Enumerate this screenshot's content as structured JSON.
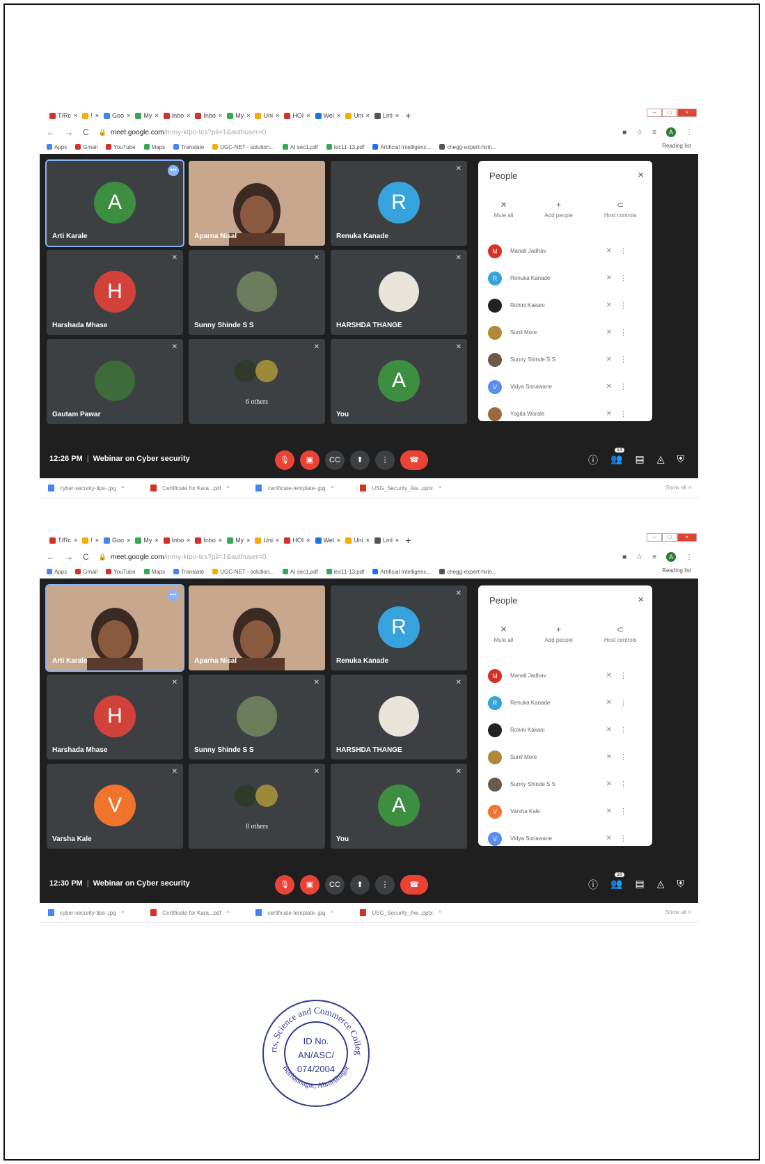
{
  "browser": {
    "tabs": [
      {
        "label": "T/Rc",
        "color": "#d93025"
      },
      {
        "label": "!",
        "color": "#f9ab00"
      },
      {
        "label": "Goo",
        "color": "#4285f4"
      },
      {
        "label": "My",
        "color": "#34a853"
      },
      {
        "label": "Inbo",
        "color": "#d93025"
      },
      {
        "label": "Inbo",
        "color": "#d93025"
      },
      {
        "label": "My",
        "color": "#34a853"
      },
      {
        "label": "Uni",
        "color": "#f9ab00"
      },
      {
        "label": "HOI",
        "color": "#d93025"
      },
      {
        "label": "Wel",
        "color": "#1a73e8"
      },
      {
        "label": "Uni",
        "color": "#f9ab00"
      },
      {
        "label": "Linl",
        "color": "#555555"
      }
    ],
    "url_host": "meet.google.com",
    "url_path_1": "/mmy-ktpo-tcs?pli=1&authuser=0",
    "url_path_2": "/mmy-ktpo-tcs?pli=1&authuser=0",
    "bookmarks": [
      {
        "label": "Apps",
        "color": "#4285f4"
      },
      {
        "label": "Gmail",
        "color": "#d93025"
      },
      {
        "label": "YouTube",
        "color": "#d93025"
      },
      {
        "label": "Maps",
        "color": "#34a853"
      },
      {
        "label": "Translate",
        "color": "#4285f4"
      },
      {
        "label": "UGC-NET - solution...",
        "color": "#f9ab00"
      },
      {
        "label": "AI sec1.pdf",
        "color": "#34a853"
      },
      {
        "label": "lec11-13.pdf",
        "color": "#34a853"
      },
      {
        "label": "Artificial Intelligenc...",
        "color": "#1a73e8"
      },
      {
        "label": "chegg-expert-hirin...",
        "color": "#555555"
      }
    ],
    "reading_list": "Reading list"
  },
  "shot1": {
    "tiles": [
      {
        "name": "Arti Karale",
        "letter": "A",
        "color": "#3e8e41",
        "kind": "avatar",
        "active": true
      },
      {
        "name": "Aparna Nisal",
        "kind": "video"
      },
      {
        "name": "Renuka Kanade",
        "letter": "R",
        "color": "#36a3dd",
        "kind": "avatar"
      },
      {
        "name": "Harshada Mhase",
        "letter": "H",
        "color": "#d3423a",
        "kind": "avatar"
      },
      {
        "name": "Sunny Shinde S S",
        "kind": "photo",
        "photo_color": "#6b7d5a"
      },
      {
        "name": "HARSHDA THANGE",
        "kind": "photo",
        "photo_color": "#e9e4da"
      },
      {
        "name": "Gautam Pawar",
        "kind": "photo",
        "photo_color": "#3e6b3a"
      },
      {
        "name": "6 others",
        "kind": "others"
      },
      {
        "name": "You",
        "letter": "A",
        "color": "#3e8e41",
        "kind": "avatar"
      }
    ],
    "people": [
      {
        "name": "Manali Jadhav",
        "letter": "M",
        "color": "#d93025"
      },
      {
        "name": "Renuka Kanade",
        "letter": "R",
        "color": "#36a3dd"
      },
      {
        "name": "Rohini Kakani",
        "letter": "",
        "color": "#222222"
      },
      {
        "name": "Sunil More",
        "letter": "",
        "color": "#b08a3a"
      },
      {
        "name": "Sunny Shinde S S",
        "letter": "",
        "color": "#6b5a4a"
      },
      {
        "name": "Vidya Sonawane",
        "letter": "V",
        "color": "#5b8def"
      },
      {
        "name": "Yogita Warale",
        "letter": "",
        "color": "#9a6a3a"
      }
    ],
    "time": "12:26 PM",
    "people_count": "14"
  },
  "shot2": {
    "tiles": [
      {
        "name": "Arti Karale",
        "kind": "video",
        "active": true
      },
      {
        "name": "Aparna Nisal",
        "kind": "video"
      },
      {
        "name": "Renuka Kanade",
        "letter": "R",
        "color": "#36a3dd",
        "kind": "avatar"
      },
      {
        "name": "Harshada Mhase",
        "letter": "H",
        "color": "#d3423a",
        "kind": "avatar"
      },
      {
        "name": "Sunny Shinde S S",
        "kind": "photo",
        "photo_color": "#6b7d5a"
      },
      {
        "name": "HARSHDA THANGE",
        "kind": "photo",
        "photo_color": "#e9e4da"
      },
      {
        "name": "Varsha Kale",
        "letter": "V",
        "color": "#f2742c",
        "kind": "avatar"
      },
      {
        "name": "8 others",
        "kind": "others"
      },
      {
        "name": "You",
        "letter": "A",
        "color": "#3e8e41",
        "kind": "avatar"
      }
    ],
    "people": [
      {
        "name": "Manali Jadhav",
        "letter": "M",
        "color": "#d93025"
      },
      {
        "name": "Renuka Kanade",
        "letter": "R",
        "color": "#36a3dd"
      },
      {
        "name": "Rohini Kakani",
        "letter": "",
        "color": "#222222"
      },
      {
        "name": "Sunil More",
        "letter": "",
        "color": "#b08a3a"
      },
      {
        "name": "Sunny Shinde S S",
        "letter": "",
        "color": "#6b5a4a"
      },
      {
        "name": "Varsha Kale",
        "letter": "V",
        "color": "#f2742c"
      },
      {
        "name": "Vidya Sonawane",
        "letter": "V",
        "color": "#5b8def"
      }
    ],
    "time": "12:30 PM",
    "people_count": "16"
  },
  "meeting_title": "Webinar on Cyber security",
  "people_panel": {
    "title": "People",
    "mute_all": "Mute all",
    "add_people": "Add people",
    "host_controls": "Host controls"
  },
  "downloads": [
    {
      "label": "cyber-security-tips-.jpg",
      "color": "#4285f4"
    },
    {
      "label": "Certificate for Kara...pdf",
      "color": "#d93025"
    },
    {
      "label": "certificate-template-.jpg",
      "color": "#4285f4"
    },
    {
      "label": "USG_Security_Aw...pptx",
      "color": "#d93025"
    }
  ],
  "show_all": "Show all",
  "seal": {
    "ring_text": "Arts, Science and Commerce College",
    "bottom_text": "Burhannagar, Ahmednagar",
    "line1": "ID No.",
    "line2": "AN/ASC/",
    "line3": "074/2004",
    "color": "#2f3a8f"
  }
}
